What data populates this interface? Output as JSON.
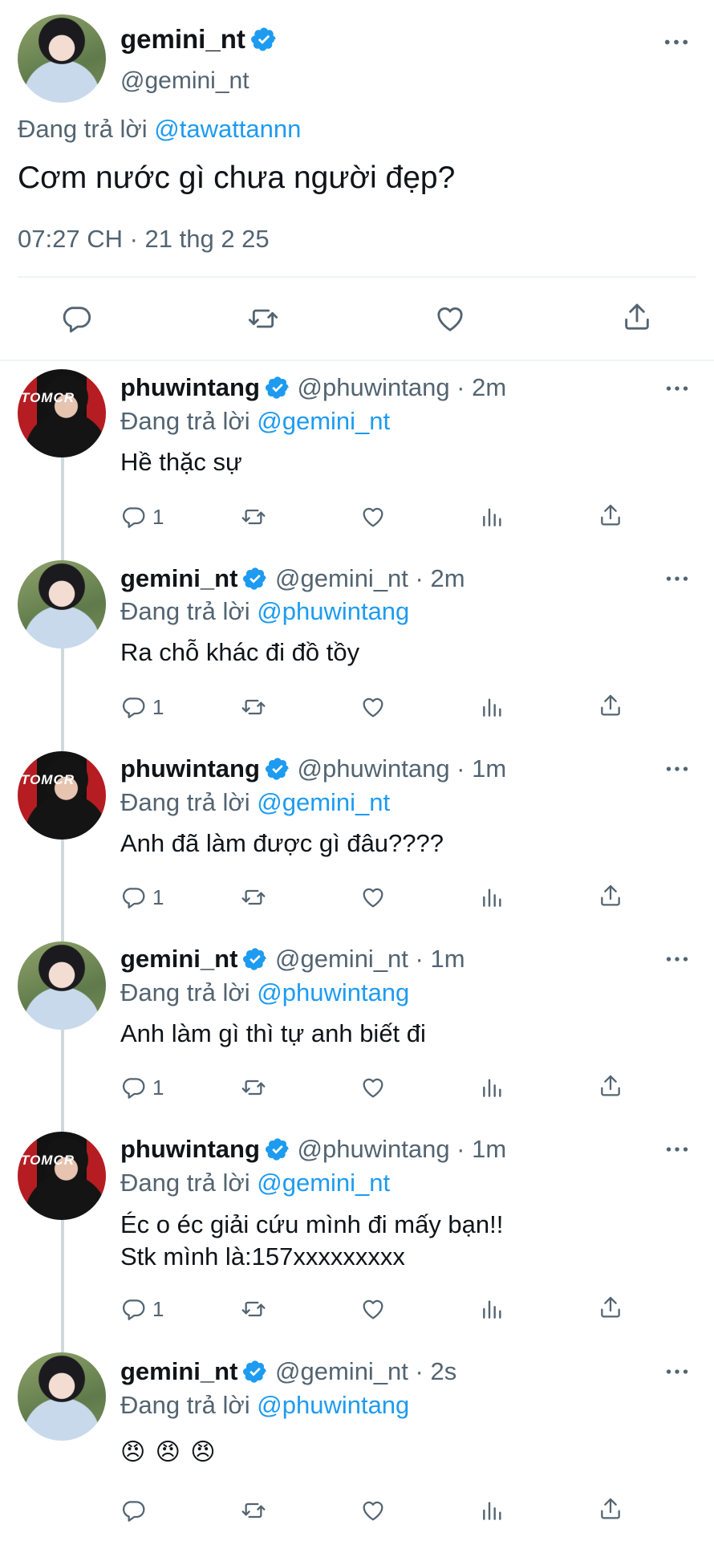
{
  "main_tweet": {
    "display_name": "gemini_nt",
    "handle": "@gemini_nt",
    "reply_prefix": "Đang trả lời",
    "reply_to": "@tawattannn",
    "text": "Cơm nước gì chưa người đẹp?",
    "timestamp": "07:27 CH · 21 thg 2 25"
  },
  "replies": [
    {
      "name": "phuwintang",
      "handle": "@phuwintang · 2m",
      "reply_prefix": "Đang trả lời",
      "reply_to": "@gemini_nt",
      "text1": "Hề thặc sự",
      "text2": "",
      "reply_count": "1"
    },
    {
      "name": "gemini_nt",
      "handle": "@gemini_nt · 2m",
      "reply_prefix": "Đang trả lời",
      "reply_to": "@phuwintang",
      "text1": "Ra chỗ khác đi đồ tồy",
      "text2": "",
      "reply_count": "1"
    },
    {
      "name": "phuwintang",
      "handle": "@phuwintang · 1m",
      "reply_prefix": "Đang trả lời",
      "reply_to": "@gemini_nt",
      "text1": "Anh đã làm được gì đâu????",
      "text2": "",
      "reply_count": "1"
    },
    {
      "name": "gemini_nt",
      "handle": "@gemini_nt · 1m",
      "reply_prefix": "Đang trả lời",
      "reply_to": "@phuwintang",
      "text1": "Anh làm gì thì tự anh biết đi",
      "text2": "",
      "reply_count": "1"
    },
    {
      "name": "phuwintang",
      "handle": "@phuwintang · 1m",
      "reply_prefix": "Đang trả lời",
      "reply_to": "@gemini_nt",
      "text1": "Éc o éc giải cứu mình đi mấy bạn!!",
      "text2": "Stk mình là:157xxxxxxxxx",
      "reply_count": "1"
    },
    {
      "name": "gemini_nt",
      "handle": "@gemini_nt · 2s",
      "reply_prefix": "Đang trả lời",
      "reply_to": "@phuwintang",
      "text1": "😠 😠 😠",
      "text2": "",
      "reply_count": ""
    }
  ],
  "avatar_brand_text": "TOMCR",
  "icons": {
    "verified": "verified-badge-icon",
    "more": "more-icon",
    "reply": "reply-icon",
    "retweet": "retweet-icon",
    "like": "like-icon",
    "views": "views-icon",
    "share": "share-icon"
  },
  "colors": {
    "link": "#1d9bf0",
    "secondary": "#536471",
    "text": "#0f1419",
    "divider": "#eff3f4"
  }
}
